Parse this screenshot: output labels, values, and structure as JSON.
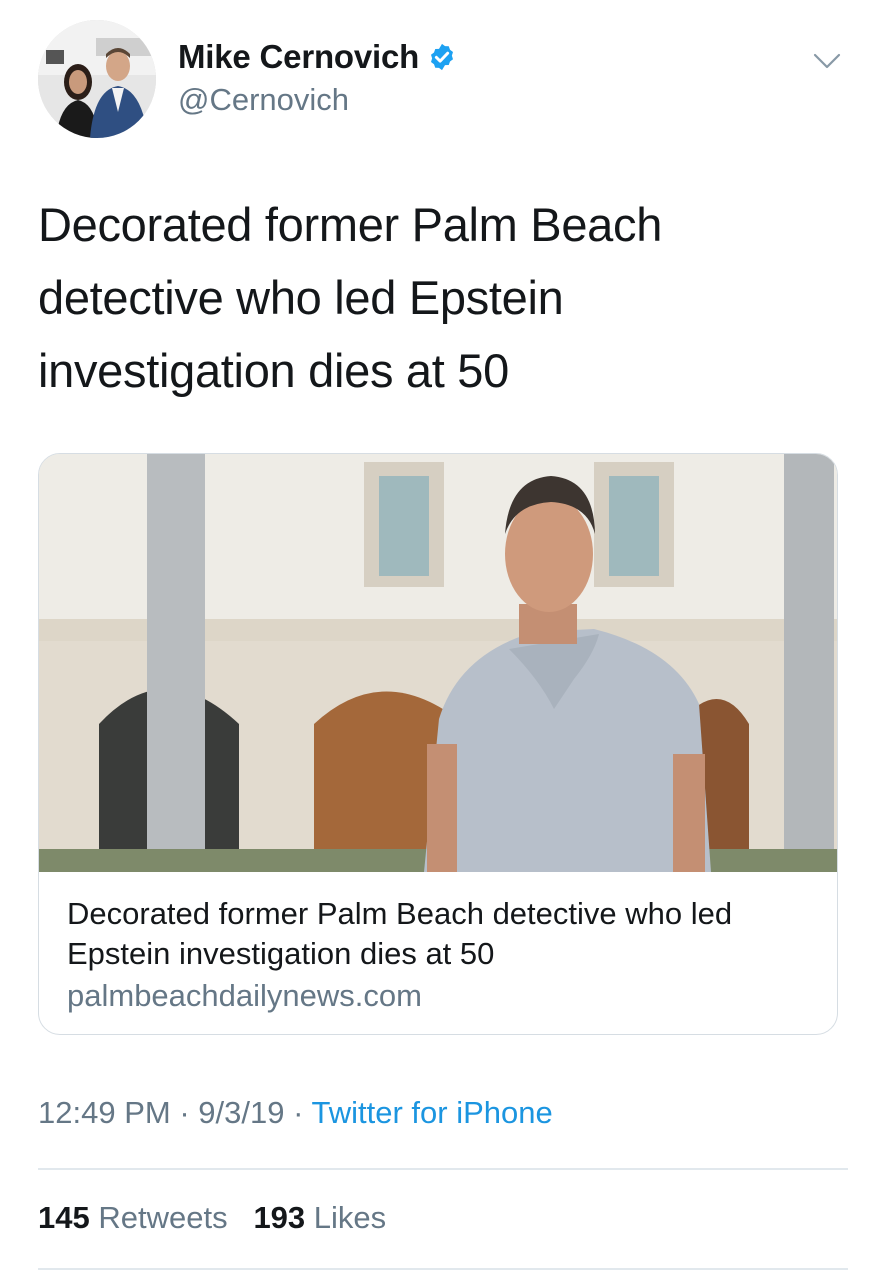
{
  "user": {
    "display_name": "Mike Cernovich",
    "handle": "@Cernovich",
    "verified": true
  },
  "header": {
    "menu_icon": "chevron-down-icon"
  },
  "tweet": {
    "text": "Decorated former Palm Beach detective who led Epstein investigation dies at 50"
  },
  "card": {
    "title": "Decorated former Palm Beach detective who led Epstein investigation dies at 50",
    "domain": "palmbeachdailynews.com"
  },
  "meta": {
    "time": "12:49 PM",
    "separator": "·",
    "date": "9/3/19",
    "source": "Twitter for iPhone"
  },
  "stats": {
    "retweets_count": "145",
    "retweets_label": "Retweets",
    "likes_count": "193",
    "likes_label": "Likes"
  },
  "colors": {
    "text": "#14171a",
    "secondary": "#657786",
    "link": "#1b95e0",
    "verified": "#1da1f2",
    "divider": "#e1e8ed"
  }
}
